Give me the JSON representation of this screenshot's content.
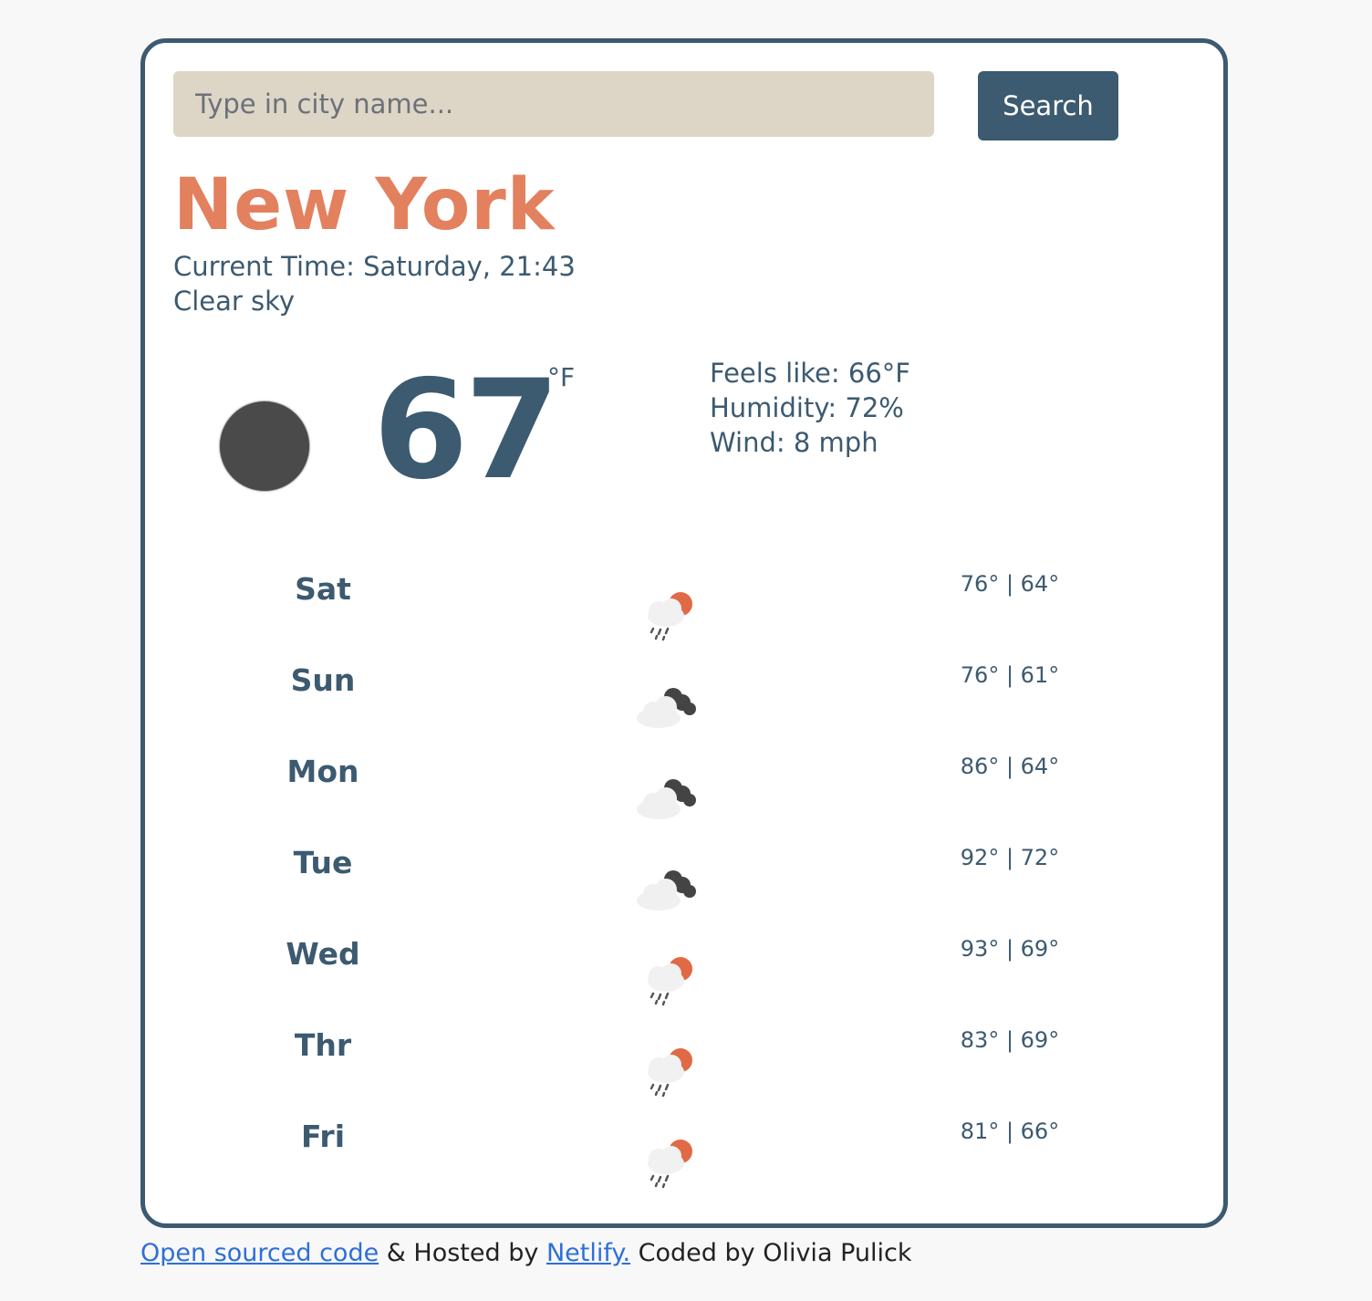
{
  "search": {
    "placeholder": "Type in city name...",
    "button_label": "Search"
  },
  "current": {
    "city": "New York",
    "time": "Current Time: Saturday, 21:43",
    "description": "Clear sky",
    "icon": "moon-icon",
    "temperature": "67",
    "unit": "°F",
    "feels_like": "Feels like: 66°F",
    "humidity": "Humidity: 72%",
    "wind": "Wind: 8 mph"
  },
  "forecast": [
    {
      "day": "Sat",
      "icon": "rain-sun-icon",
      "temps": "76° | 64°"
    },
    {
      "day": "Sun",
      "icon": "cloudy-night-icon",
      "temps": "76° | 61°"
    },
    {
      "day": "Mon",
      "icon": "cloudy-night-icon",
      "temps": "86° | 64°"
    },
    {
      "day": "Tue",
      "icon": "cloudy-night-icon",
      "temps": "92° | 72°"
    },
    {
      "day": "Wed",
      "icon": "rain-sun-icon",
      "temps": "93° | 69°"
    },
    {
      "day": "Thr",
      "icon": "rain-sun-icon",
      "temps": "83° | 69°"
    },
    {
      "day": "Fri",
      "icon": "rain-sun-icon",
      "temps": "81° | 66°"
    }
  ],
  "footer": {
    "source_link": "Open sourced code",
    "hosted_text": " & Hosted by ",
    "netlify_link": "Netlify.",
    "credit_text": " Coded by Olivia Pulick"
  },
  "colors": {
    "accent": "#e3805e",
    "primary": "#3c5a70",
    "input_bg": "#ddd5c6",
    "link": "#2e6fd8"
  }
}
